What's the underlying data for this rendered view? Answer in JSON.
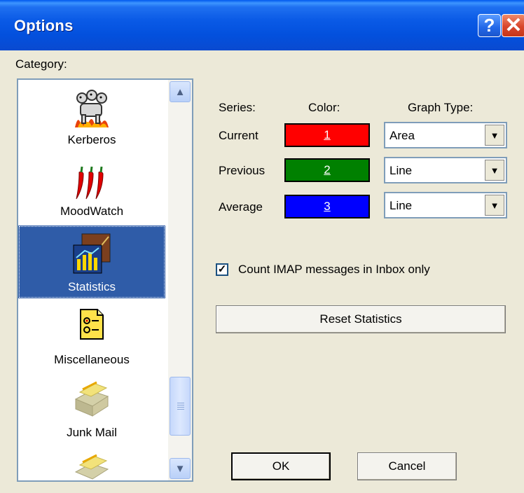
{
  "window": {
    "title": "Options"
  },
  "titlebar": {
    "help_glyph": "?",
    "close_glyph": "✕"
  },
  "category": {
    "label": "Category:",
    "items": [
      {
        "label": "Kerberos",
        "icon": "kerberos-dog-icon",
        "selected": false
      },
      {
        "label": "MoodWatch",
        "icon": "chili-peppers-icon",
        "selected": false
      },
      {
        "label": "Statistics",
        "icon": "statistics-chart-icon",
        "selected": true
      },
      {
        "label": "Miscellaneous",
        "icon": "miscellaneous-options-icon",
        "selected": false
      },
      {
        "label": "Junk Mail",
        "icon": "junk-mail-icon",
        "selected": false
      }
    ]
  },
  "series": {
    "header_series": "Series:",
    "header_color": "Color:",
    "header_graph_type": "Graph Type:",
    "rows": [
      {
        "name": "Current",
        "color_label": "1",
        "color": "#ff0000",
        "graph_type": "Area"
      },
      {
        "name": "Previous",
        "color_label": "2",
        "color": "#008000",
        "graph_type": "Line"
      },
      {
        "name": "Average",
        "color_label": "3",
        "color": "#0000ff",
        "graph_type": "Line"
      }
    ]
  },
  "options": {
    "count_imap_label": "Count IMAP messages in Inbox only",
    "count_imap_checked": true
  },
  "buttons": {
    "reset": "Reset Statistics",
    "ok": "OK",
    "cancel": "Cancel"
  }
}
